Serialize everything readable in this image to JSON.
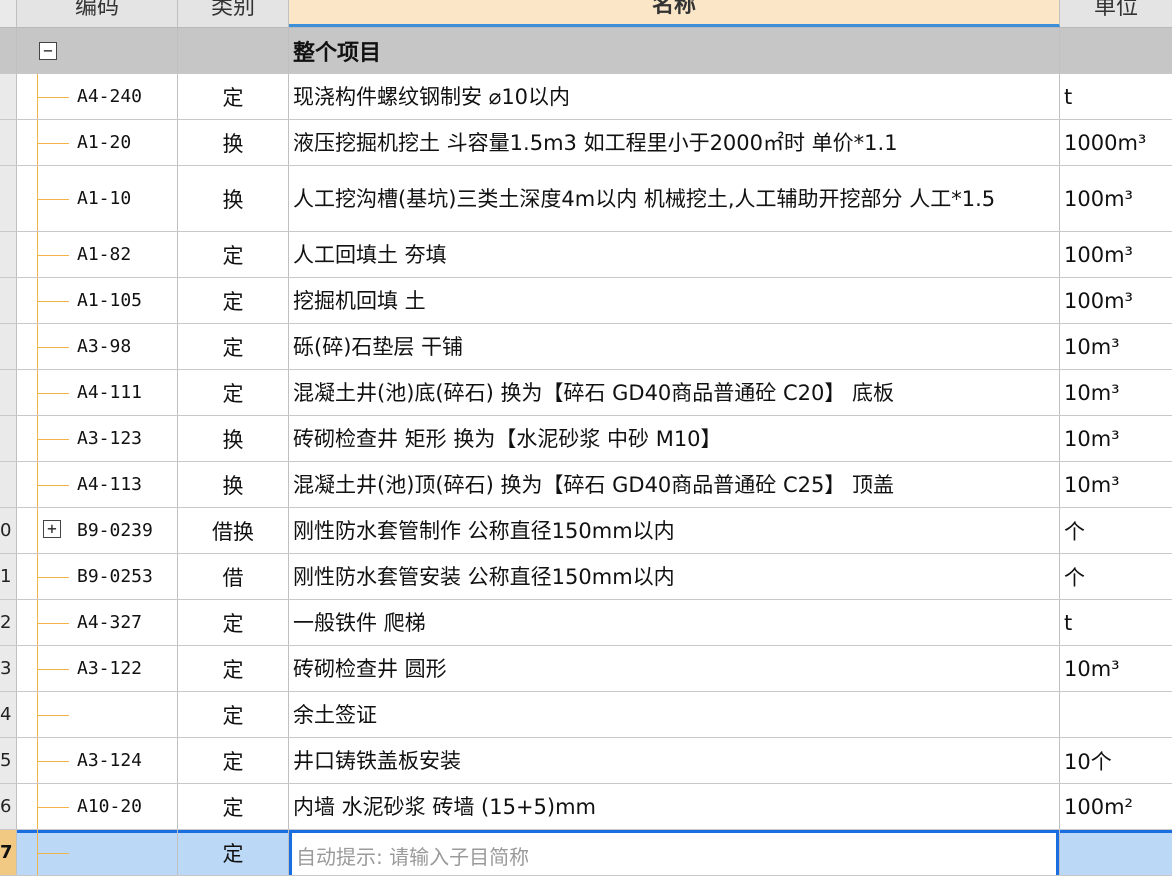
{
  "header": {
    "code": "编码",
    "type": "类别",
    "name": "名称",
    "unit": "单位"
  },
  "group": {
    "expander": "−",
    "name": "整个项目"
  },
  "rows": [
    {
      "num": "",
      "code": "A4-240",
      "type": "定",
      "name": "现浇构件螺纹钢制安 ⌀10以内",
      "unit": "t"
    },
    {
      "num": "",
      "code": "A1-20",
      "type": "换",
      "name": "液压挖掘机挖土 斗容量1.5m3 如工程里小于2000㎡时 单价*1.1",
      "unit": "1000m³"
    },
    {
      "num": "",
      "code": "A1-10",
      "type": "换",
      "name": "人工挖沟槽(基坑)三类土深度4m以内  机械挖土,人工辅助开挖部分 人工*1.5",
      "unit": "100m³"
    },
    {
      "num": "",
      "code": "A1-82",
      "type": "定",
      "name": "人工回填土 夯填",
      "unit": "100m³"
    },
    {
      "num": "",
      "code": "A1-105",
      "type": "定",
      "name": "挖掘机回填 土",
      "unit": "100m³"
    },
    {
      "num": "",
      "code": "A3-98",
      "type": "定",
      "name": "砾(碎)石垫层 干铺",
      "unit": "10m³"
    },
    {
      "num": "",
      "code": "A4-111",
      "type": "定",
      "name": "混凝土井(池)底(碎石)  换为【碎石 GD40商品普通砼 C20】 底板",
      "unit": "10m³"
    },
    {
      "num": "",
      "code": "A3-123",
      "type": "换",
      "name": "砖砌检查井 矩形  换为【水泥砂浆 中砂 M10】",
      "unit": "10m³"
    },
    {
      "num": "",
      "code": "A4-113",
      "type": "换",
      "name": "混凝土井(池)顶(碎石)  换为【碎石 GD40商品普通砼 C25】 顶盖",
      "unit": "10m³"
    },
    {
      "num": "0",
      "code": "B9-0239",
      "type": "借换",
      "name": "刚性防水套管制作 公称直径150mm以内",
      "unit": "个",
      "expander": "+"
    },
    {
      "num": "1",
      "code": "B9-0253",
      "type": "借",
      "name": "刚性防水套管安装 公称直径150mm以内",
      "unit": "个"
    },
    {
      "num": "2",
      "code": "A4-327",
      "type": "定",
      "name": "一般铁件  爬梯",
      "unit": "t"
    },
    {
      "num": "3",
      "code": "A3-122",
      "type": "定",
      "name": "砖砌检查井 圆形",
      "unit": "10m³"
    },
    {
      "num": "4",
      "code": "",
      "type": "定",
      "name": "余土签证",
      "unit": ""
    },
    {
      "num": "5",
      "code": "A3-124",
      "type": "定",
      "name": "井口铸铁盖板安装",
      "unit": "10个"
    },
    {
      "num": "6",
      "code": "A10-20",
      "type": "定",
      "name": "内墙 水泥砂浆 砖墙 (15+5)mm",
      "unit": "100m²"
    }
  ],
  "edit_row": {
    "num": "7",
    "type": "定",
    "placeholder": "自动提示: 请输入子目简称"
  }
}
